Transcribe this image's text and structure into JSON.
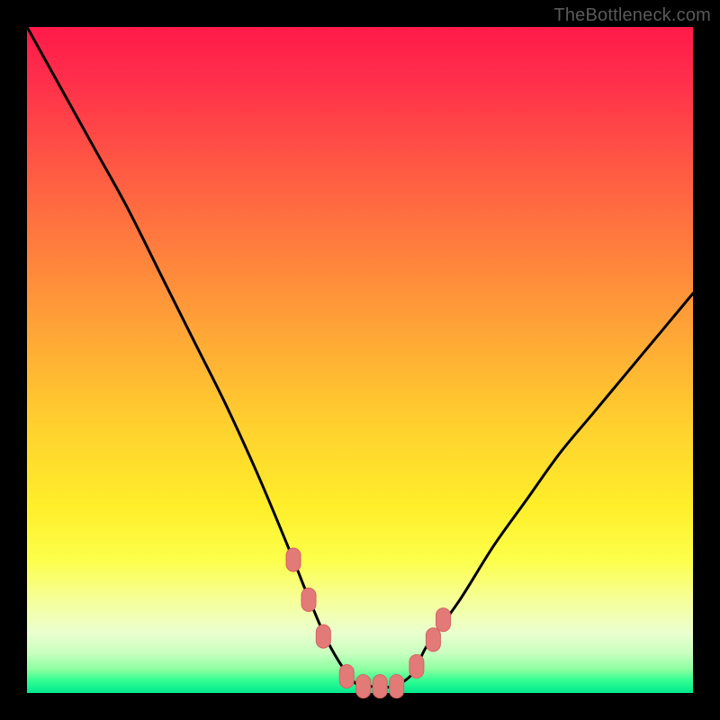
{
  "attribution": {
    "text": "TheBottleneck.com"
  },
  "colors": {
    "frame": "#000000",
    "curve": "#000000",
    "marker_fill": "#e27a78",
    "marker_stroke": "#d46360"
  },
  "chart_data": {
    "type": "line",
    "title": "",
    "xlabel": "",
    "ylabel": "",
    "xlim": [
      0,
      100
    ],
    "ylim": [
      0,
      100
    ],
    "grid": false,
    "legend": false,
    "series": [
      {
        "name": "bottleneck-curve",
        "x": [
          0,
          5,
          10,
          15,
          20,
          25,
          30,
          35,
          40,
          42,
          45,
          48,
          50,
          52,
          55,
          58,
          60,
          65,
          70,
          75,
          80,
          85,
          90,
          95,
          100
        ],
        "values": [
          100,
          91,
          82,
          73,
          63,
          53,
          43,
          32,
          20,
          15,
          8,
          3,
          1,
          1,
          1,
          3,
          7,
          14,
          22,
          29,
          36,
          42,
          48,
          54,
          60
        ]
      }
    ],
    "markers": [
      {
        "x": 40.0,
        "y": 20.0
      },
      {
        "x": 42.3,
        "y": 14.0
      },
      {
        "x": 44.5,
        "y": 8.5
      },
      {
        "x": 48.0,
        "y": 2.5
      },
      {
        "x": 50.5,
        "y": 1.0
      },
      {
        "x": 53.0,
        "y": 1.0
      },
      {
        "x": 55.5,
        "y": 1.0
      },
      {
        "x": 58.5,
        "y": 4.0
      },
      {
        "x": 61.0,
        "y": 8.0
      },
      {
        "x": 62.5,
        "y": 11.0
      }
    ]
  }
}
